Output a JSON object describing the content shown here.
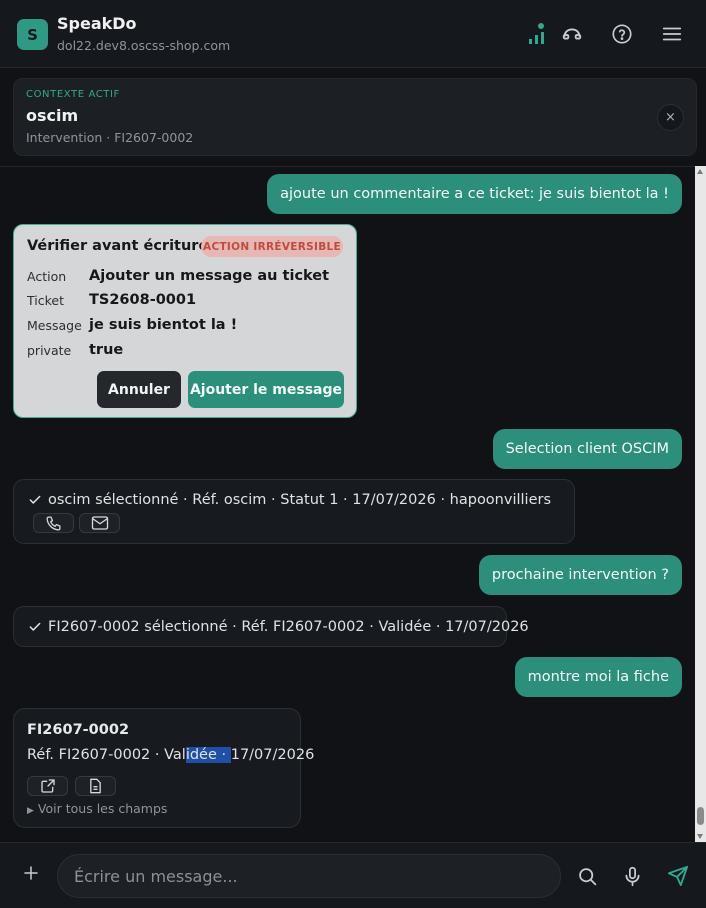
{
  "header": {
    "logo_letter": "S",
    "app_name": "SpeakDo",
    "host": "dol22.dev8.oscss-shop.com",
    "icons": [
      "signal-icon",
      "headset-icon",
      "help-icon",
      "menu-icon"
    ]
  },
  "context": {
    "kicker": "CONTEXTE ACTIF",
    "name": "oscim",
    "subtitle": "Intervention · FI2607-0002",
    "close_label": "×"
  },
  "messages": {
    "user1": "ajoute un commentaire a ce ticket: je suis bientot la !",
    "user2": "Selection client OSCIM",
    "user3": "prochaine intervention ?",
    "user4": "montre moi la fiche"
  },
  "verify": {
    "title": "Vérifier avant écriture",
    "badge": "ACTION IRRÉVERSIBLE",
    "rows": [
      {
        "key": "Action",
        "value": "Ajouter un message au ticket"
      },
      {
        "key": "Ticket",
        "value": "TS2608-0001"
      },
      {
        "key": "Message",
        "value": "je suis bientot la !"
      },
      {
        "key": "private",
        "value": "true"
      }
    ],
    "cancel_label": "Annuler",
    "confirm_label": "Ajouter le message"
  },
  "client_result": {
    "text": "oscim sélectionné · Réf. oscim · Statut 1 · 17/07/2026 · hapoonvilliers",
    "icons": [
      "phone-icon",
      "mail-icon"
    ]
  },
  "intervention_result": {
    "text": "FI2607-0002 sélectionné · Réf. FI2607-0002 · Validée · 17/07/2026"
  },
  "fiche": {
    "title": "FI2607-0002",
    "line_before": "Réf. FI2607-0002 · Val",
    "line_highlight": "idée · ",
    "line_after": "17/07/2026",
    "more_label": "Voir tous les champs",
    "icons": [
      "external-link-icon",
      "document-icon"
    ]
  },
  "composer": {
    "placeholder": "Écrire un message...",
    "icons": [
      "plus-icon",
      "search-icon",
      "microphone-icon",
      "send-icon"
    ]
  },
  "colors": {
    "accent": "#2b8f7c",
    "background": "#101215",
    "danger": "#c04b3f"
  }
}
